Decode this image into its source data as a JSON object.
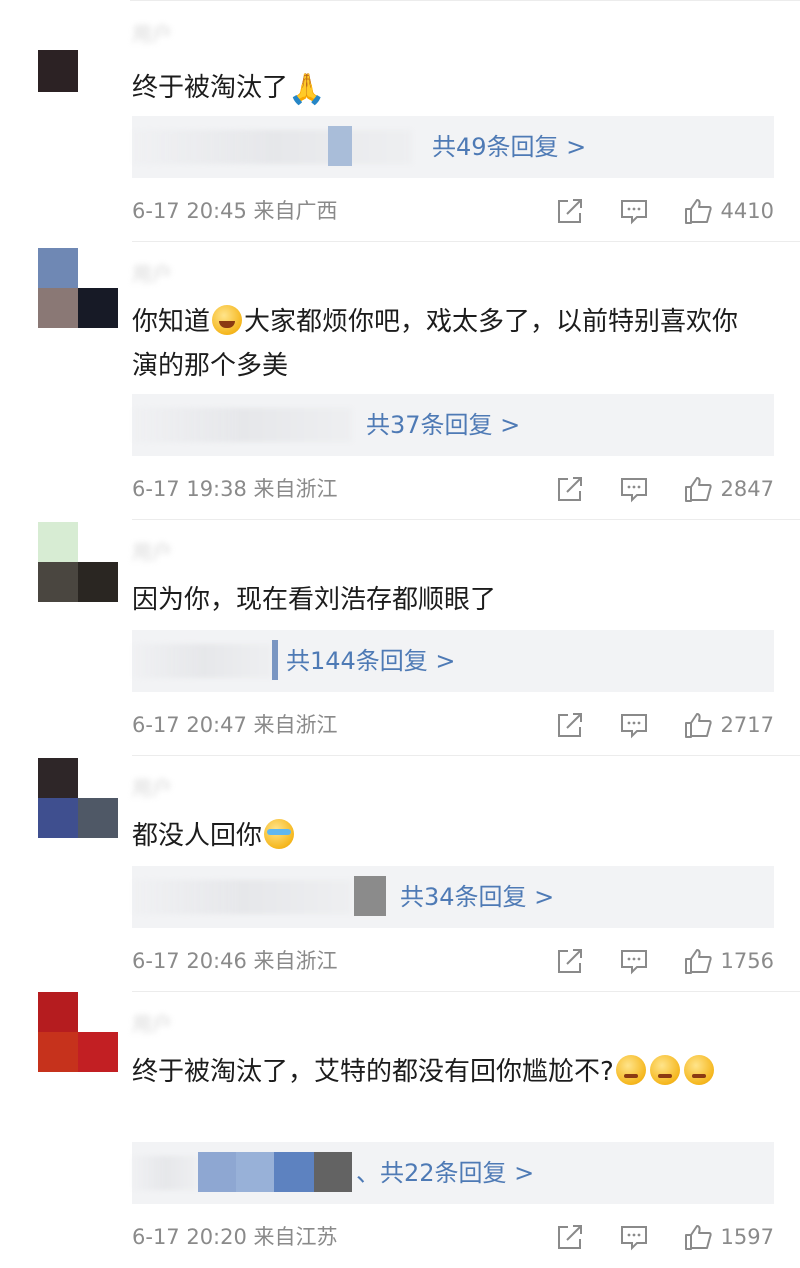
{
  "comments": [
    {
      "username": "...",
      "text": "终于被淘汰了",
      "emoji": [
        "pray-emoji"
      ],
      "reply_count_label": "共49条回复 >",
      "time": "6-17 20:45",
      "location": "来自广西",
      "likes": "4410"
    },
    {
      "username": "...",
      "text_before": "你知道",
      "text_after": "大家都烦你吧，戏太多了，以前特别喜欢你演的那个多美",
      "emoji": [
        "laughing-tears-emoji"
      ],
      "reply_count_label": "共37条回复 >",
      "time": "6-17 19:38",
      "location": "来自浙江",
      "likes": "2847"
    },
    {
      "username": "...",
      "text": "因为你，现在看刘浩存都顺眼了",
      "reply_count_label": "共144条回复 >",
      "time": "6-17 20:47",
      "location": "来自浙江",
      "likes": "2717"
    },
    {
      "username": "...",
      "text": "都没人回你",
      "emoji": [
        "crying-emoji"
      ],
      "reply_count_label": "共34条回复 >",
      "time": "6-17 20:46",
      "location": "来自浙江",
      "likes": "1756"
    },
    {
      "username": "...",
      "text": "终于被淘汰了，艾特的都没有回你尴尬不?",
      "emoji": [
        "thinking-emoji",
        "thinking-emoji",
        "thinking-emoji"
      ],
      "reply_count_label": "、共22条回复 >",
      "time": "6-17 20:20",
      "location": "来自江苏",
      "likes": "1597"
    }
  ],
  "colors": {
    "link": "#4e7ab5",
    "meta": "#8a8a8a",
    "reply_bg": "#f2f3f5"
  },
  "icons": [
    "share-icon",
    "comment-icon",
    "like-icon"
  ]
}
